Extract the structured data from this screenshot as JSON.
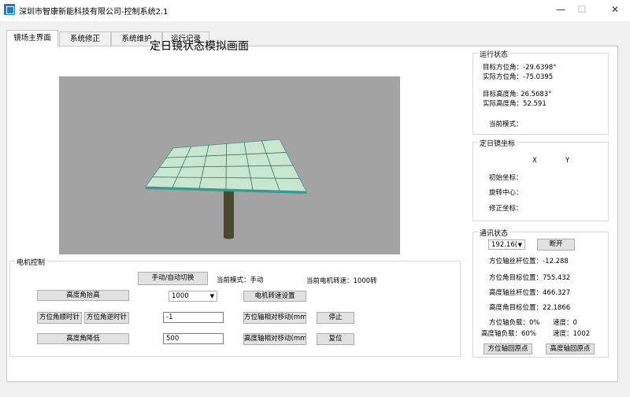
{
  "window": {
    "title": "深圳市智康新能科技有限公司-控制系统2.1",
    "minimize": "—",
    "maximize": "☐",
    "close": "✕"
  },
  "tabs": [
    "镜场主界面",
    "系统修正",
    "系统维护",
    "运行记录"
  ],
  "scene": {
    "title": "定日镜状态模拟画面"
  },
  "colors": {
    "panel": "#c9e6d0",
    "panel_edge": "#3a9a92",
    "pole": "#4a4830",
    "viewport_bg": "#a3a3a3"
  },
  "motor": {
    "legend": "电机控制",
    "switch_button": "手动/自动切换",
    "mode_label": "当前模式：手动",
    "speed_label": "当前电机转速：1000转",
    "raise_button": "高度角抬高",
    "speed_combo": "1000",
    "speed_set_button": "电机转速设置",
    "cw_button": "方位角顺时针",
    "ccw_button": "方位角逆时针",
    "step_value": "-1",
    "azimuth_move_button": "方位轴相对移动(mm)",
    "stop_button": "停止",
    "lower_button": "高度角降低",
    "lower_value": "500",
    "altitude_move_button": "高度轴相对移动(mm)",
    "reset_button": "复位"
  },
  "run_status": {
    "legend": "运行状态",
    "target_azimuth": "目标方位角：-29.6398°",
    "actual_azimuth": "实际方位角：-75.0395",
    "target_altitude": "目标高度角: 26.5683°",
    "actual_altitude": "实际高度角：52.591",
    "current_mode": "当前模式："
  },
  "coords": {
    "legend": "定日镜坐标",
    "x_header": "X",
    "y_header": "Y",
    "initial": "初始坐标：",
    "rotation_center": "旋转中心：",
    "corrected": "修正坐标："
  },
  "comm": {
    "legend": "通讯状态",
    "ip": "192.16(",
    "disconnect_button": "断开",
    "az_screw": "方位轴丝杆位置：-12.288",
    "az_target": "方位角目标位置：755.432",
    "alt_screw": "高度轴丝杆位置：466.327",
    "alt_target": "高度角目标位置：22.1866",
    "az_load": "方位轴负载：0%",
    "az_speed": "速度：0",
    "alt_load": "高度轴负载：60%",
    "alt_speed": "速度：1002",
    "az_home_button": "方位轴回原点",
    "alt_home_button": "高度轴回原点"
  }
}
